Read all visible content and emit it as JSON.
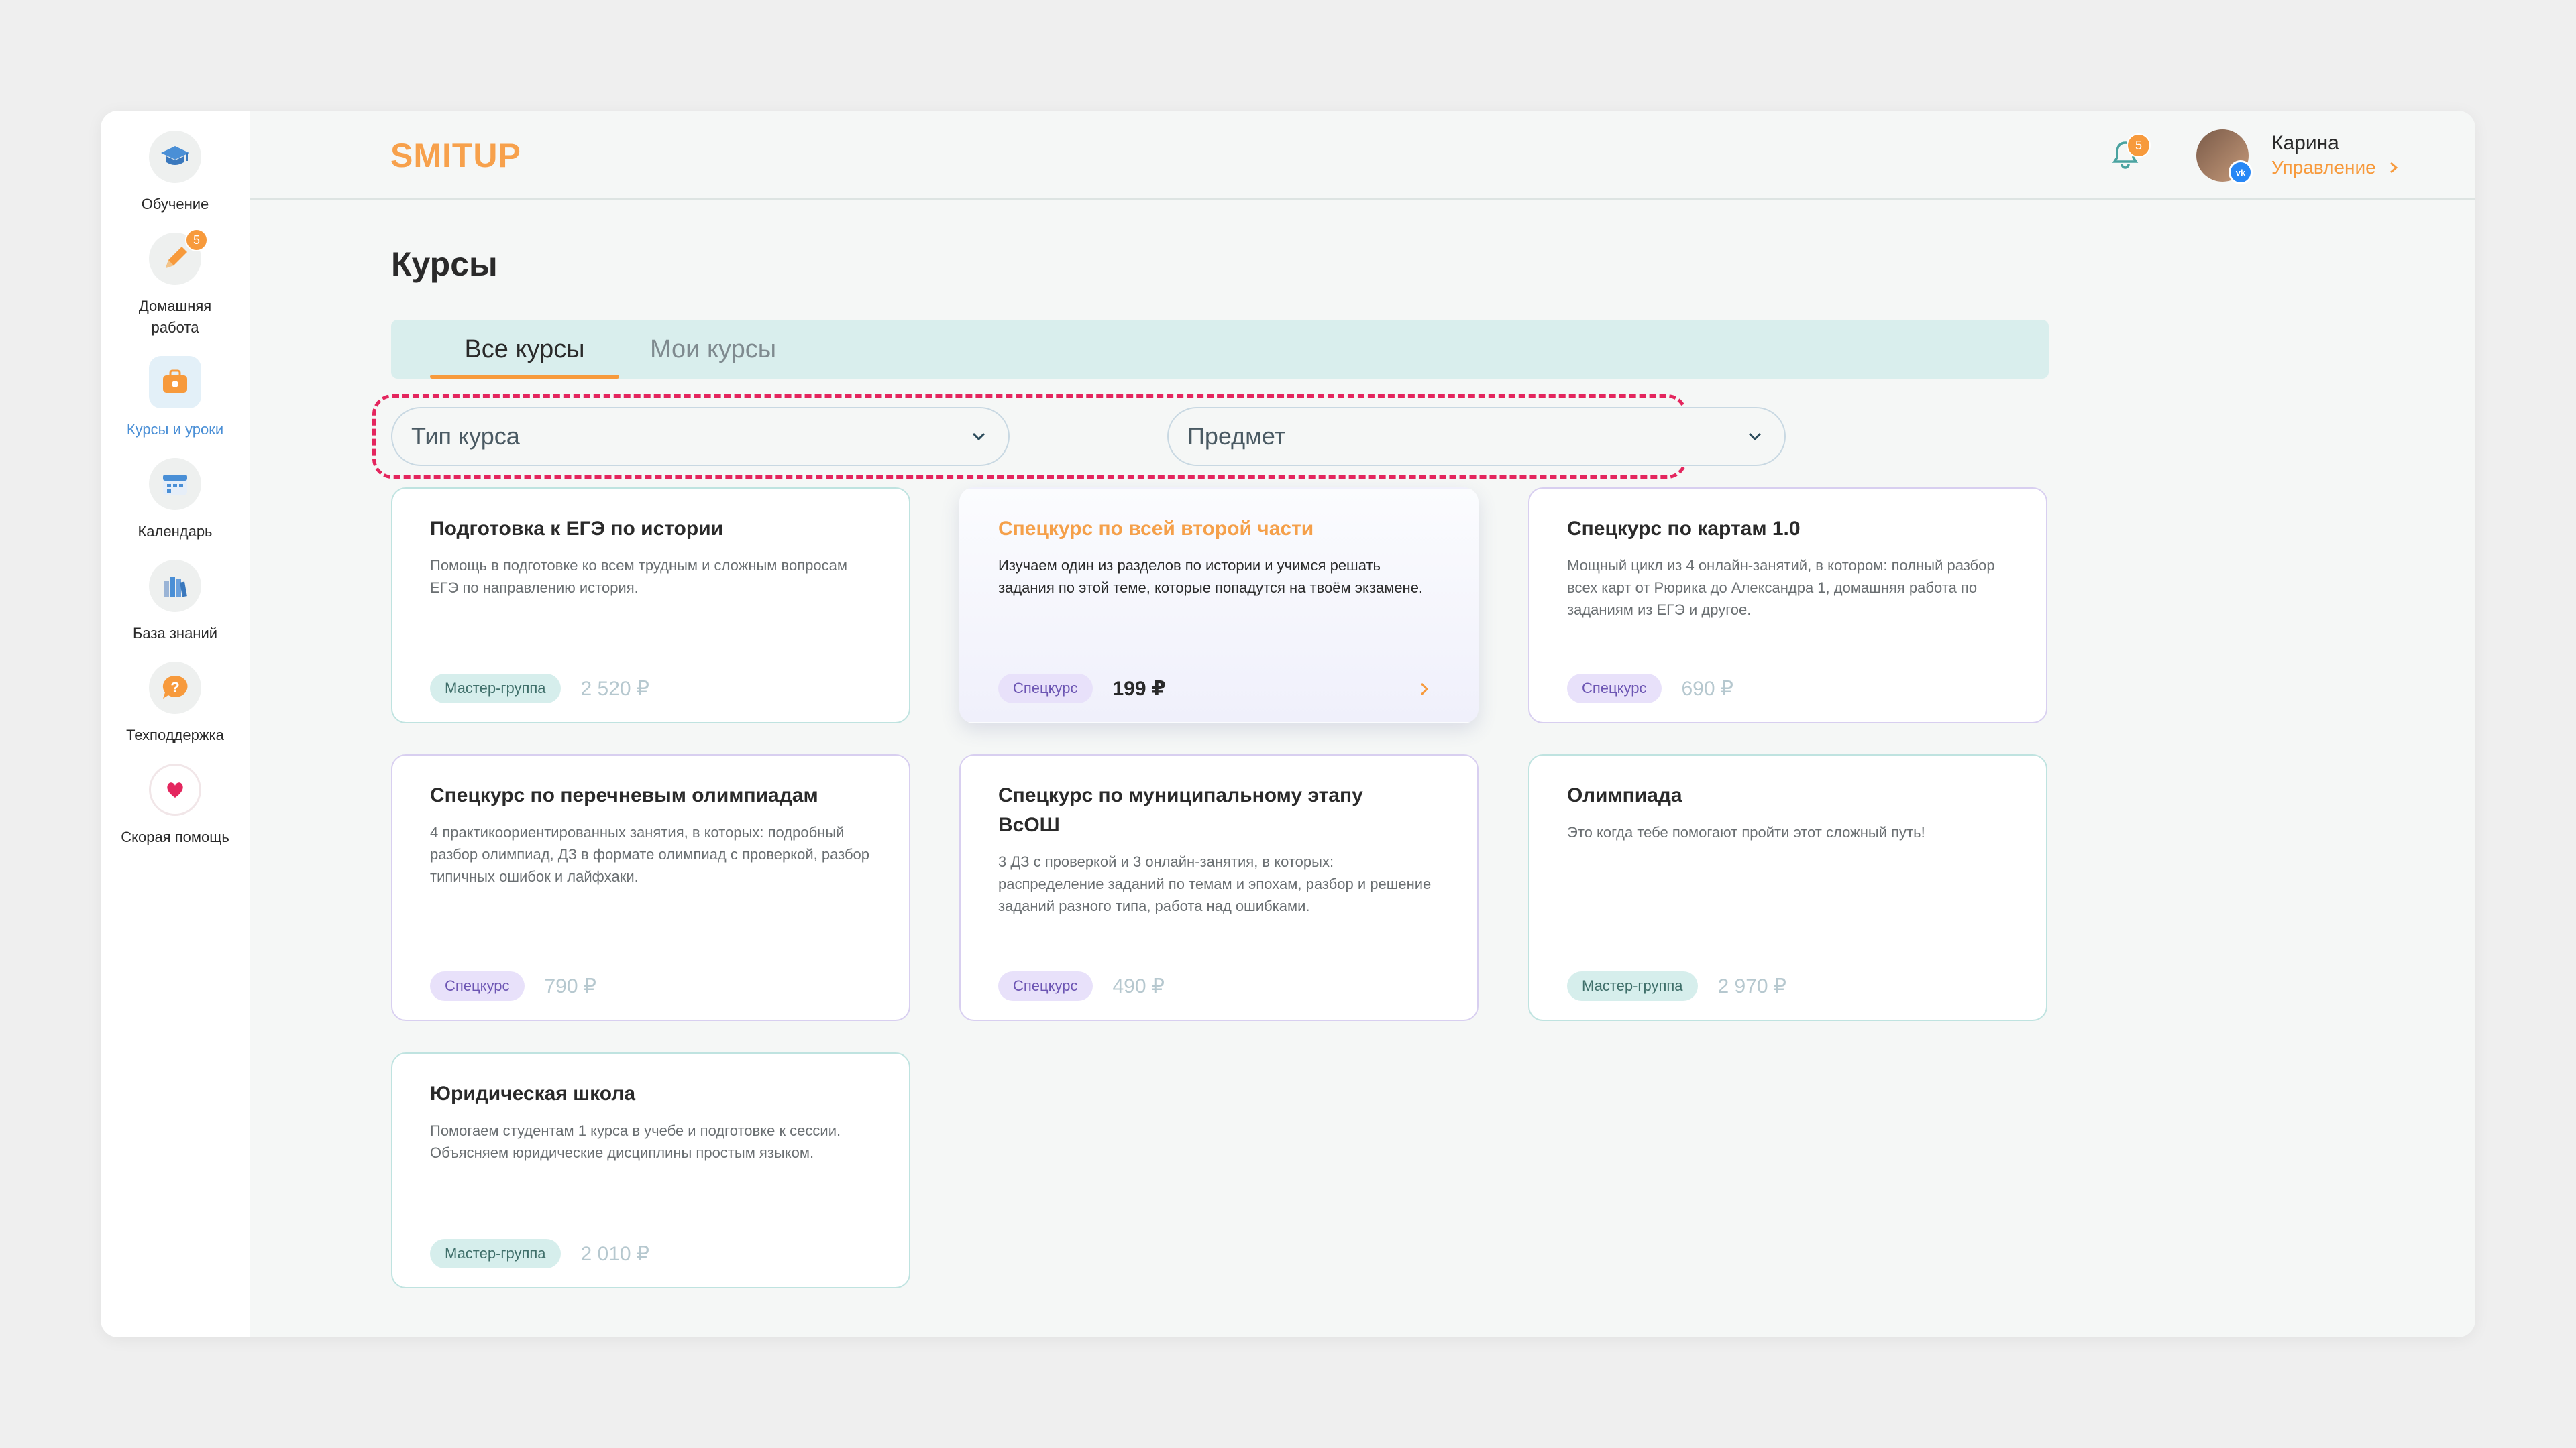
{
  "sidebar": {
    "items": [
      {
        "label": "Обучение",
        "icon": "graduation-cap-icon"
      },
      {
        "label": "Домашняя работа",
        "icon": "pencil-icon",
        "badge": "5"
      },
      {
        "label": "Курсы и уроки",
        "icon": "briefcase-icon",
        "active": true
      },
      {
        "label": "Календарь",
        "icon": "calendar-icon"
      },
      {
        "label": "База знаний",
        "icon": "books-icon"
      },
      {
        "label": "Техподдержка",
        "icon": "question-bubble-icon"
      },
      {
        "label": "Скорая помощь",
        "icon": "heart-icon"
      }
    ]
  },
  "header": {
    "logo": "SMITUP",
    "notifications_badge": "5",
    "user": {
      "name": "Карина",
      "manage_label": "Управление"
    }
  },
  "main": {
    "title": "Курсы",
    "tabs": [
      {
        "label": "Все курсы",
        "active": true
      },
      {
        "label": "Мои курсы",
        "active": false
      }
    ],
    "filters": [
      {
        "placeholder": "Тип курса"
      },
      {
        "placeholder": "Предмет"
      }
    ],
    "courses": [
      {
        "title": "Подготовка к ЕГЭ по истории",
        "desc": "Помощь в подготовке ко всем трудным и сложным вопросам ЕГЭ по направлению история.",
        "tag": "Мастер-группа",
        "price": "2 520 ₽"
      },
      {
        "title": "Спецкурс по всей второй части",
        "desc": "Изучаем один из разделов по истории и учимся решать задания по этой теме, которые попадутся на твоём экзамене.",
        "tag": "Спецкурс",
        "price": "199 ₽"
      },
      {
        "title": "Спецкурс по картам 1.0",
        "desc": "Мощный цикл из 4 онлайн-занятий, в котором: полный разбор всех карт от Рюрика до Александра 1, домашняя работа по заданиям из ЕГЭ и другое.",
        "tag": "Спецкурс",
        "price": "690 ₽"
      },
      {
        "title": "Спецкурс по перечневым олимпиадам",
        "desc": "4 практикоориентированных занятия, в которых: подробный разбор олимпиад, ДЗ в формате олимпиад с проверкой, разбор типичных ошибок и лайфхаки.",
        "tag": "Спецкурс",
        "price": "790 ₽"
      },
      {
        "title": "Спецкурс по муниципальному этапу ВсОШ",
        "desc": "3 ДЗ с проверкой и 3 онлайн-занятия, в которых: распределение заданий по темам и эпохам, разбор и решение заданий разного типа, работа над ошибками.",
        "tag": "Спецкурс",
        "price": "490 ₽"
      },
      {
        "title": "Олимпиада",
        "desc": "Это когда тебе помогают пройти этот сложный путь!",
        "tag": "Мастер-группа",
        "price": "2 970 ₽"
      },
      {
        "title": "Юридическая школа",
        "desc": "Помогаем студентам 1 курса в учебе и подготовке к сессии. Объясняем юридические дисциплины простым языком.",
        "tag": "Мастер-группа",
        "price": "2 010 ₽"
      }
    ]
  },
  "colors": {
    "accent": "#f79a3c",
    "highlight_border": "#e4265e",
    "active_nav": "#4a8fd6"
  }
}
